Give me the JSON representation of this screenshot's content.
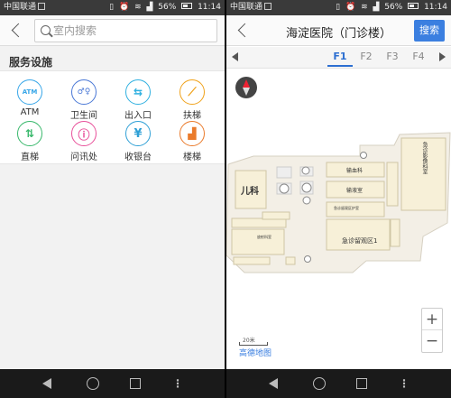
{
  "left_screen": {
    "status": {
      "carrier": "中国联通",
      "battery": "56%",
      "time": "11:14"
    },
    "search": {
      "placeholder": "室内搜索"
    },
    "section_title": "服务设施",
    "services": [
      {
        "label": "ATM",
        "icon_text": "ATM",
        "icon": "atm-icon",
        "color": "#37a6e8"
      },
      {
        "label": "卫生间",
        "icon_text": "♂♀",
        "icon": "restroom-icon",
        "color": "#4a78d6"
      },
      {
        "label": "出入口",
        "icon_text": "⇆",
        "icon": "entrance-icon",
        "color": "#2fb0e0"
      },
      {
        "label": "扶梯",
        "icon_text": "⟋",
        "icon": "escalator-icon",
        "color": "#f0a21b"
      },
      {
        "label": "直梯",
        "icon_text": "⇅",
        "icon": "elevator-icon",
        "color": "#38b86b"
      },
      {
        "label": "问讯处",
        "icon_text": "ⓘ",
        "icon": "info-desk-icon",
        "color": "#e8509a"
      },
      {
        "label": "收银台",
        "icon_text": "¥",
        "icon": "cashier-icon",
        "color": "#2fa0d6"
      },
      {
        "label": "楼梯",
        "icon_text": "▟",
        "icon": "stairs-icon",
        "color": "#ea7b2c"
      }
    ]
  },
  "right_screen": {
    "status": {
      "carrier": "中国联通",
      "battery": "56%",
      "time": "11:14"
    },
    "title": "海淀医院（门诊楼）",
    "search_button": "搜索",
    "floors": [
      "F1",
      "F2",
      "F3",
      "F4"
    ],
    "active_floor": "F1",
    "map": {
      "rooms": {
        "pediatrics": "儿科",
        "blood_transfusion": "输血科",
        "infusion_room": "输液室",
        "emergency_ward": "急诊留观区1",
        "emergency_nurse": "急诊留观区护室",
        "radiology": "急诊影像科室",
        "small_room": "放射科室"
      },
      "scale_label": "20米",
      "logo": "高德地图"
    }
  }
}
